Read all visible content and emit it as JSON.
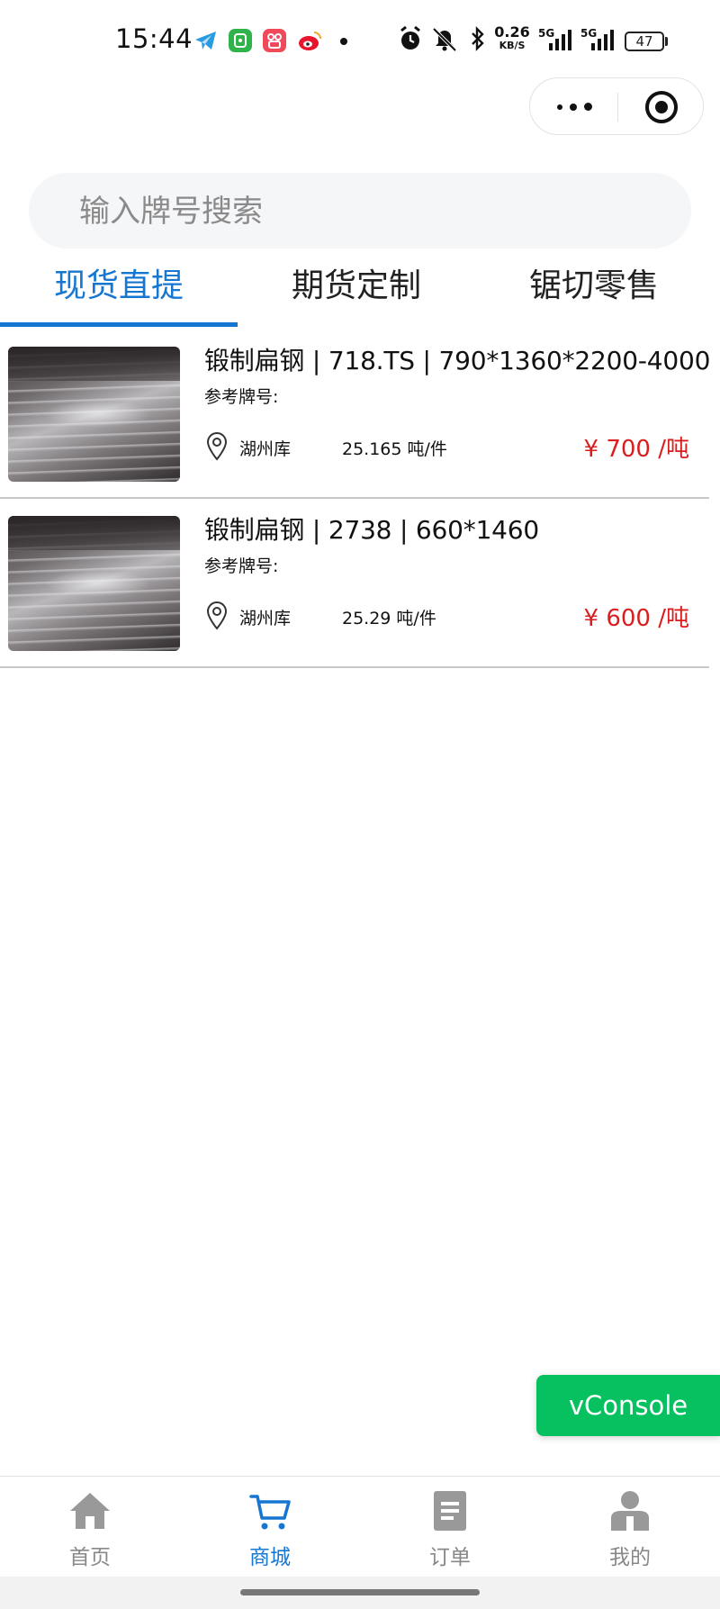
{
  "status_bar": {
    "time": "15:44",
    "net_speed_value": "0.26",
    "net_speed_unit": "KB/S",
    "signal1_label": "5G",
    "signal2_label": "5G",
    "battery": "47"
  },
  "search": {
    "placeholder": "输入牌号搜索"
  },
  "tabs": [
    {
      "label": "现货直提"
    },
    {
      "label": "期货定制"
    },
    {
      "label": "锯切零售"
    }
  ],
  "products": [
    {
      "title": "锻制扁钢 | 718.TS | 790*1360*2200-4000",
      "ref_label": "参考牌号:",
      "warehouse": "湖州库",
      "weight": "25.165 吨/件",
      "price": "¥ 700 /吨"
    },
    {
      "title": "锻制扁钢 | 2738 | 660*1460",
      "ref_label": "参考牌号:",
      "warehouse": "湖州库",
      "weight": "25.29 吨/件",
      "price": "¥ 600 /吨"
    }
  ],
  "vconsole": {
    "label": "vConsole"
  },
  "bottom_nav": [
    {
      "label": "首页",
      "icon": "home-icon"
    },
    {
      "label": "商城",
      "icon": "cart-icon"
    },
    {
      "label": "订单",
      "icon": "order-icon"
    },
    {
      "label": "我的",
      "icon": "user-icon"
    }
  ],
  "colors": {
    "accent": "#1677d2",
    "price": "#d81e1e",
    "vconsole": "#07c160"
  }
}
